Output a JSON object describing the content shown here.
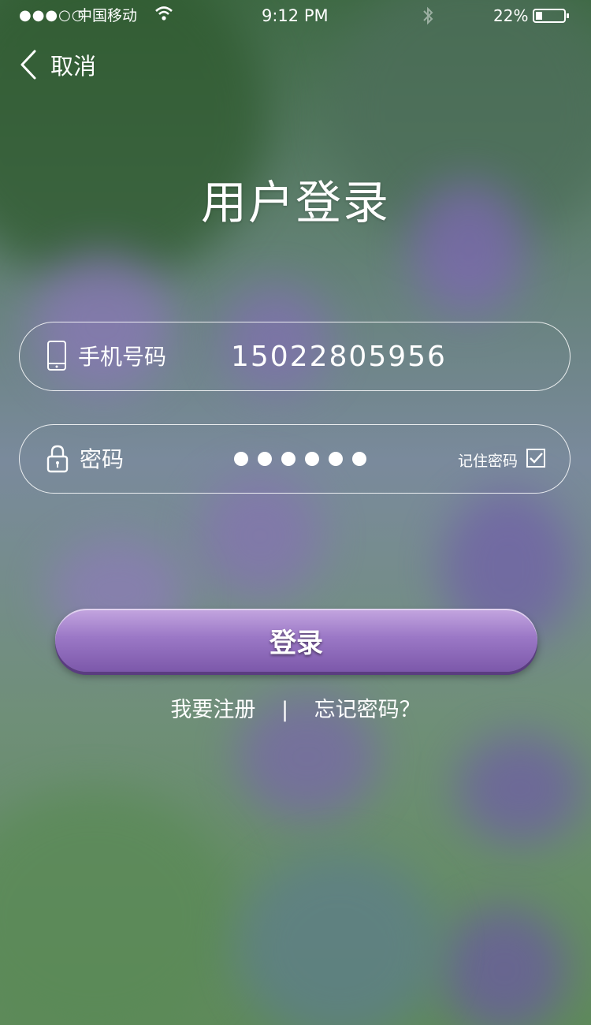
{
  "status_bar": {
    "signal": "●●●○○",
    "carrier": "中国移动",
    "time": "9:12 PM",
    "battery": "22%"
  },
  "nav": {
    "back_label": "取消"
  },
  "page": {
    "title": "用户登录"
  },
  "form": {
    "phone_label": "手机号码",
    "phone_value": "15022805956",
    "password_label": "密码",
    "password_length": 6,
    "remember_label": "记住密码",
    "remember_checked": true
  },
  "actions": {
    "login_label": "登录",
    "register_label": "我要注册",
    "separator": "|",
    "forgot_label": "忘记密码？"
  },
  "colors": {
    "accent": "#9b78c6",
    "text": "#ffffff"
  }
}
